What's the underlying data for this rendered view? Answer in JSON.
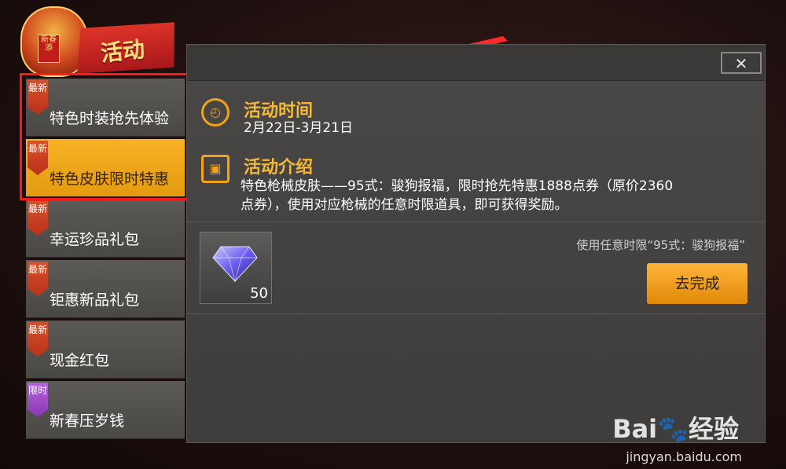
{
  "header": {
    "title": "活动",
    "tag_text": "新春添"
  },
  "sidebar": {
    "items": [
      {
        "badge": "最新",
        "label": "特色时装抢先体验",
        "badge_color": "#d7502a",
        "active": false
      },
      {
        "badge": "最新",
        "label": "特色皮肤限时特惠",
        "badge_color": "#d7502a",
        "active": true
      },
      {
        "badge": "最新",
        "label": "幸运珍品礼包",
        "badge_color": "#d7502a",
        "active": false
      },
      {
        "badge": "最新",
        "label": "钜惠新品礼包",
        "badge_color": "#d7502a",
        "active": false
      },
      {
        "badge": "最新",
        "label": "现金红包",
        "badge_color": "#d7502a",
        "active": false
      },
      {
        "badge": "限时",
        "label": "新春压岁钱",
        "badge_color": "#b465d9",
        "active": false
      }
    ]
  },
  "panel": {
    "close_label": "✕",
    "time_section": {
      "icon": "clock-icon",
      "title": "活动时间",
      "value": "2月22日-3月21日"
    },
    "intro_section": {
      "icon": "gift-bag-icon",
      "title": "活动介绍",
      "text_line1": "特色枪械皮肤——95式：骏狗报福，限时抢先特惠1888点券（原价2360",
      "text_line2": "点券），使用对应枪械的任意时限道具，即可获得奖励。"
    },
    "task": {
      "reward_icon": "diamond-icon",
      "reward_count": "50",
      "description": "使用任意时限“95式：骏狗报福”",
      "button_label": "去完成"
    }
  },
  "watermark": {
    "brand": "Bai",
    "brand_suffix": "经验",
    "url": "jingyan.baidu.com"
  },
  "colors": {
    "accent": "#f2a319",
    "active_tab": "#f0a91a",
    "highlight_box": "#ff1a1a"
  }
}
